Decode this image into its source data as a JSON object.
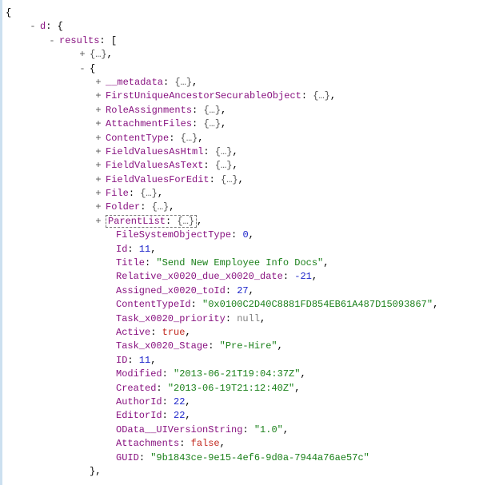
{
  "punct": {
    "open_brace": "{",
    "close_brace": "}",
    "open_bracket": "[",
    "comma": ",",
    "colon": ": ",
    "collapsed": "{…}",
    "plus": "+",
    "minus": "-"
  },
  "root": {
    "d_key": "d",
    "results_key": "results"
  },
  "item0_collapsed": "{…}",
  "expandables": [
    {
      "key": "__metadata",
      "val": "{…}"
    },
    {
      "key": "FirstUniqueAncestorSecurableObject",
      "val": "{…}"
    },
    {
      "key": "RoleAssignments",
      "val": "{…}"
    },
    {
      "key": "AttachmentFiles",
      "val": "{…}"
    },
    {
      "key": "ContentType",
      "val": "{…}"
    },
    {
      "key": "FieldValuesAsHtml",
      "val": "{…}"
    },
    {
      "key": "FieldValuesAsText",
      "val": "{…}"
    },
    {
      "key": "FieldValuesForEdit",
      "val": "{…}"
    },
    {
      "key": "File",
      "val": "{…}"
    },
    {
      "key": "Folder",
      "val": "{…}"
    },
    {
      "key": "ParentList",
      "val": "{…}"
    }
  ],
  "props": [
    {
      "key": "FileSystemObjectType",
      "type": "number",
      "val": "0"
    },
    {
      "key": "Id",
      "type": "number",
      "val": "11"
    },
    {
      "key": "Title",
      "type": "string",
      "val": "\"Send New Employee Info Docs\""
    },
    {
      "key": "Relative_x0020_due_x0020_date",
      "type": "number",
      "val": "-21"
    },
    {
      "key": "Assigned_x0020_toId",
      "type": "number",
      "val": "27"
    },
    {
      "key": "ContentTypeId",
      "type": "string",
      "val": "\"0x0100C2D40C8881FD854EB61A487D15093867\""
    },
    {
      "key": "Task_x0020_priority",
      "type": "null",
      "val": "null"
    },
    {
      "key": "Active",
      "type": "bool",
      "val": "true"
    },
    {
      "key": "Task_x0020_Stage",
      "type": "string",
      "val": "\"Pre-Hire\""
    },
    {
      "key": "ID",
      "type": "number",
      "val": "11"
    },
    {
      "key": "Modified",
      "type": "string",
      "val": "\"2013-06-21T19:04:37Z\""
    },
    {
      "key": "Created",
      "type": "string",
      "val": "\"2013-06-19T21:12:40Z\""
    },
    {
      "key": "AuthorId",
      "type": "number",
      "val": "22"
    },
    {
      "key": "EditorId",
      "type": "number",
      "val": "22"
    },
    {
      "key": "OData__UIVersionString",
      "type": "string",
      "val": "\"1.0\""
    },
    {
      "key": "Attachments",
      "type": "bool",
      "val": "false"
    },
    {
      "key": "GUID",
      "type": "string",
      "val": "\"9b1843ce-9e15-4ef6-9d0a-7944a76ae57c\""
    }
  ]
}
